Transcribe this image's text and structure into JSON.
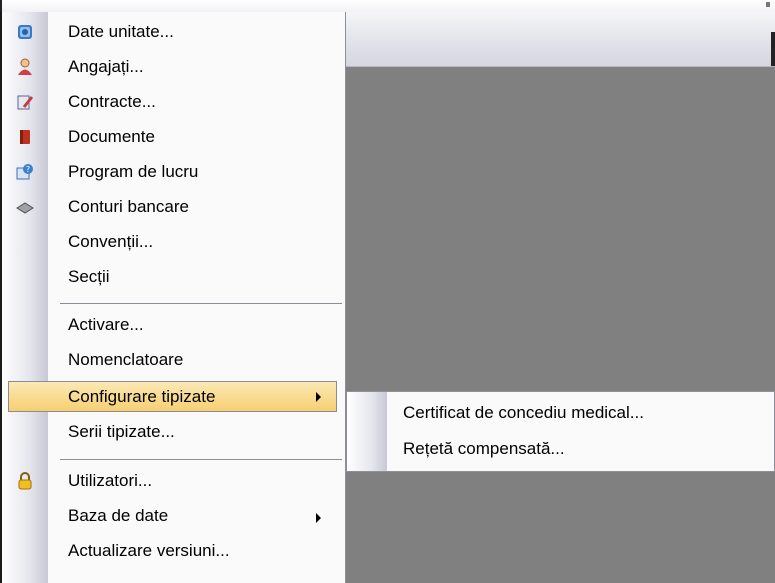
{
  "menu": {
    "items": [
      {
        "label": "Date unitate...",
        "icon": "building-info-icon"
      },
      {
        "label": "Angajați...",
        "icon": "person-icon"
      },
      {
        "label": "Contracte...",
        "icon": "document-pen-icon"
      },
      {
        "label": "Documente",
        "icon": "book-icon"
      },
      {
        "label": "Program de lucru",
        "icon": "schedule-help-icon"
      },
      {
        "label": "Conturi bancare",
        "icon": "bank-card-icon"
      },
      {
        "label": "Convenții...",
        "icon": ""
      },
      {
        "label": "Secții",
        "icon": ""
      },
      {
        "label": "Activare...",
        "icon": ""
      },
      {
        "label": "Nomenclatoare",
        "icon": ""
      },
      {
        "label": "Configurare tipizate",
        "icon": "",
        "submenu": true,
        "highlighted": true
      },
      {
        "label": "Serii tipizate...",
        "icon": ""
      },
      {
        "label": "Utilizatori...",
        "icon": "lock-icon"
      },
      {
        "label": "Baza de date",
        "icon": "",
        "submenu": true
      },
      {
        "label": "Actualizare versiuni...",
        "icon": ""
      }
    ]
  },
  "submenu": {
    "items": [
      {
        "label": "Certificat de concediu medical..."
      },
      {
        "label": "Rețetă compensată..."
      }
    ]
  },
  "colors": {
    "highlight_top": "#fbe9b5",
    "highlight_bottom": "#f7cf72",
    "workspace": "#808080"
  }
}
